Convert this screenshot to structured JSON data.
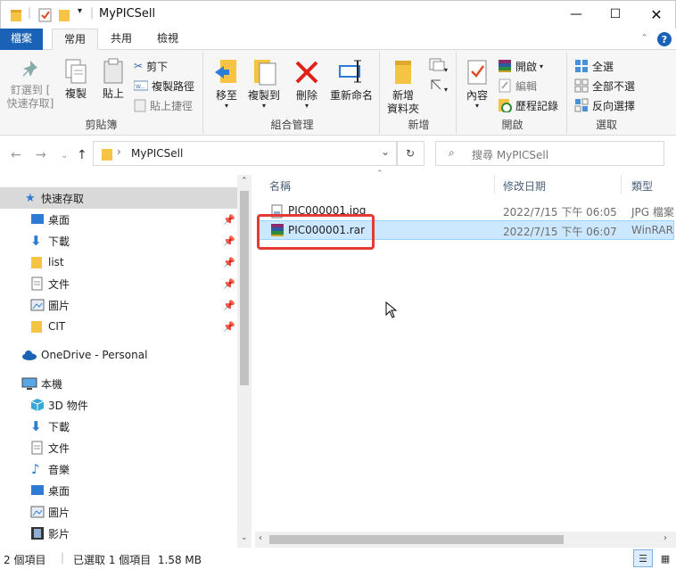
{
  "window": {
    "title": "MyPICSell"
  },
  "ribbon_tabs": [
    "檔案",
    "常用",
    "共用",
    "檢視"
  ],
  "ribbon": {
    "clipboard": {
      "pin": "釘選到 [\n快速存取]",
      "copy": "複製",
      "paste": "貼上",
      "cut": "剪下",
      "copy_path": "複製路徑",
      "paste_shortcut": "貼上捷徑",
      "label": "剪貼簿"
    },
    "organize": {
      "move_to": "移至",
      "copy_to": "複製到",
      "delete": "刪除",
      "rename": "重新命名",
      "label": "組合管理"
    },
    "new": {
      "new_folder": "新增\n資料夾",
      "label": "新增"
    },
    "open": {
      "properties": "內容",
      "open": "開啟",
      "edit": "編輯",
      "history": "歷程記錄",
      "label": "開啟"
    },
    "select": {
      "select_all": "全選",
      "select_none": "全部不選",
      "invert": "反向選擇",
      "label": "選取"
    }
  },
  "address": {
    "path": "MyPICSell",
    "search_placeholder": "搜尋 MyPICSell"
  },
  "sidebar": {
    "quick_access": "快速存取",
    "quick_items": [
      "桌面",
      "下載",
      "list",
      "文件",
      "圖片",
      "CIT"
    ],
    "onedrive": "OneDrive - Personal",
    "this_pc": "本機",
    "pc_items": [
      "3D 物件",
      "下載",
      "文件",
      "音樂",
      "桌面",
      "圖片",
      "影片"
    ]
  },
  "columns": {
    "name": "名稱",
    "modified": "修改日期",
    "type": "類型"
  },
  "files": [
    {
      "name": "PIC000001.jpg",
      "modified": "2022/7/15 下午 06:05",
      "type": "JPG 檔案"
    },
    {
      "name": "PIC000001.rar",
      "modified": "2022/7/15 下午 06:07",
      "type": "WinRAR"
    }
  ],
  "status": {
    "count": "2 個項目",
    "selected": "已選取 1 個項目  1.58 MB"
  },
  "colors": {
    "accent": "#1a62b6",
    "selection": "#cce8ff",
    "highlight": "#e53935"
  }
}
